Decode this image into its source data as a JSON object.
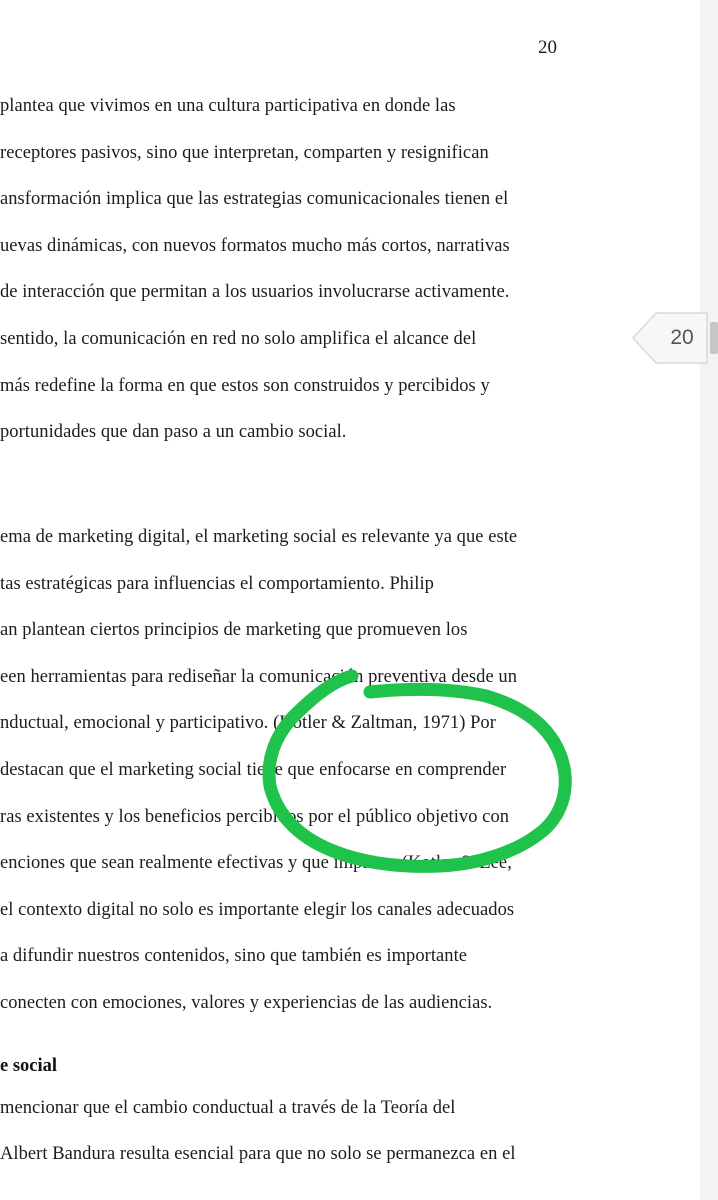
{
  "document": {
    "page_number": "20",
    "lines": [
      "plantea que vivimos en una cultura participativa en donde las",
      "receptores pasivos, sino que interpretan, comparten y resignifican",
      "ansformación implica que las estrategias comunicacionales tienen el",
      "uevas dinámicas, con nuevos formatos mucho más cortos, narrativas",
      "de interacción que permitan a los usuarios involucrarse activamente.",
      "sentido, la comunicación en red no solo amplifica el alcance del",
      "más redefine la forma en que estos son construidos y percibidos y",
      "portunidades que dan paso a un cambio social.",
      "ema de marketing digital, el marketing social es relevante ya que este",
      "tas estratégicas para influencias el comportamiento. Philip",
      "an plantean ciertos principios de marketing que promueven los",
      "een herramientas para rediseñar la comunicación preventiva desde un",
      "nductual, emocional y participativo. (Kotler & Zaltman, 1971) Por",
      "destacan que el marketing social tiene que enfocarse en comprender",
      "ras existentes y los beneficios percibidos por el público objetivo con",
      "enciones que sean realmente efectivas y que impacte. (Kotler & Lee,",
      "el contexto digital no solo es importante elegir los canales adecuados",
      "a difundir nuestros contenidos, sino que también es importante",
      "conecten con emociones, valores y experiencias de las audiencias.",
      "mencionar que el cambio conductual a través de la Teoría del",
      "Albert Bandura resulta esencial para que no solo se permanezca en el"
    ],
    "heading": "e social"
  },
  "page_indicator": {
    "label": "20"
  },
  "annotation": {
    "color": "#1fc24a"
  }
}
